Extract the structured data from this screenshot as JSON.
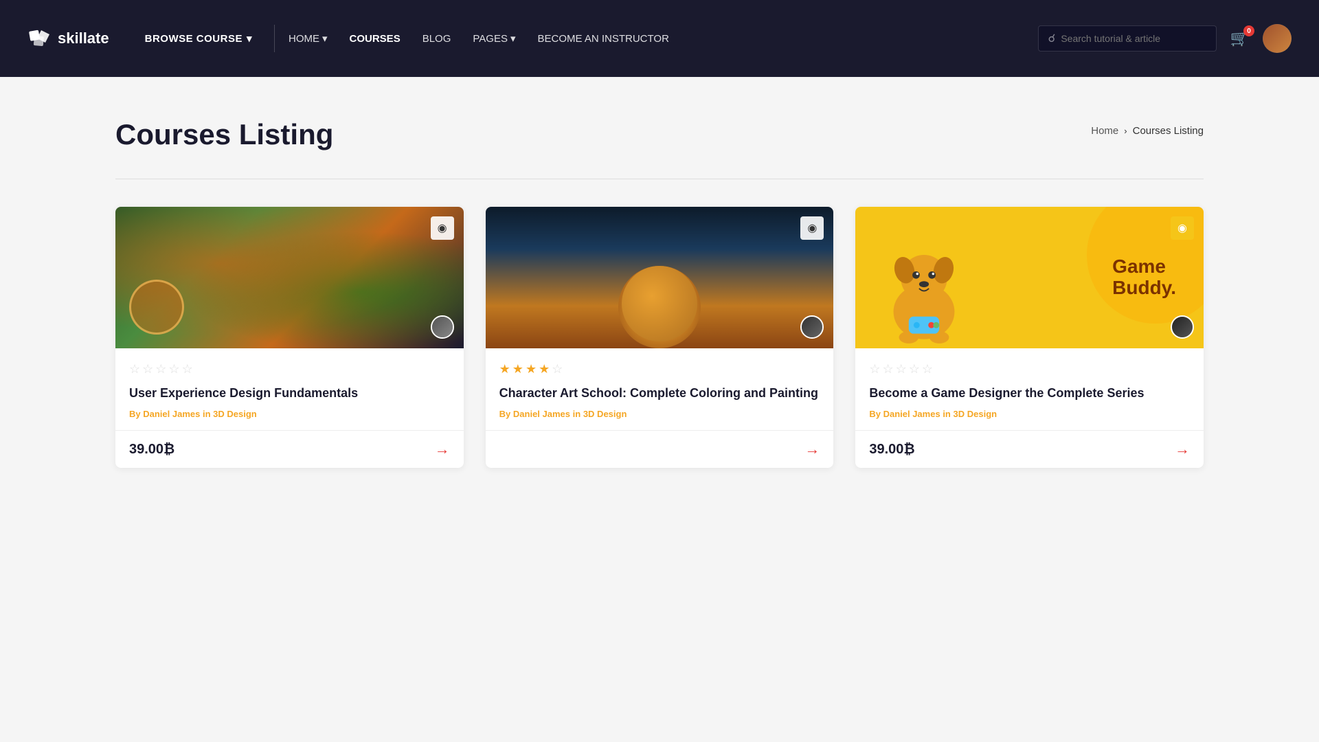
{
  "navbar": {
    "logo_text": "skillate",
    "browse_course_label": "BROWSE COURSE",
    "nav_links": [
      {
        "id": "home",
        "label": "HOME",
        "has_dropdown": true
      },
      {
        "id": "courses",
        "label": "COURSES",
        "has_dropdown": false,
        "active": true
      },
      {
        "id": "blog",
        "label": "BLOG",
        "has_dropdown": false
      },
      {
        "id": "pages",
        "label": "PAGES",
        "has_dropdown": true
      },
      {
        "id": "become",
        "label": "BECOME AN INSTRUCTOR",
        "has_dropdown": false
      }
    ],
    "search_placeholder": "Search tutorial & article",
    "cart_count": "0"
  },
  "page": {
    "title": "Courses Listing",
    "breadcrumb_home": "Home",
    "breadcrumb_current": "Courses Listing"
  },
  "courses": [
    {
      "id": "course-1",
      "title": "User Experience Design Fundamentals",
      "author": "Daniel James",
      "category": "3D Design",
      "price": "39.00₿",
      "rating": 0,
      "stars_filled": 0,
      "bookmarked": false,
      "image_type": "card1"
    },
    {
      "id": "course-2",
      "title": "Character Art School: Complete Coloring and Painting",
      "author": "Daniel James",
      "category": "3D Design",
      "price": "",
      "rating": 4,
      "stars_filled": 4,
      "bookmarked": false,
      "image_type": "card2"
    },
    {
      "id": "course-3",
      "title": "Become a Game Designer the Complete Series",
      "author": "Daniel James",
      "category": "3D Design",
      "price": "39.00₿",
      "rating": 0,
      "stars_filled": 0,
      "bookmarked": true,
      "image_type": "card3"
    }
  ],
  "labels": {
    "by": "By",
    "in": "in",
    "arrow": "→"
  }
}
